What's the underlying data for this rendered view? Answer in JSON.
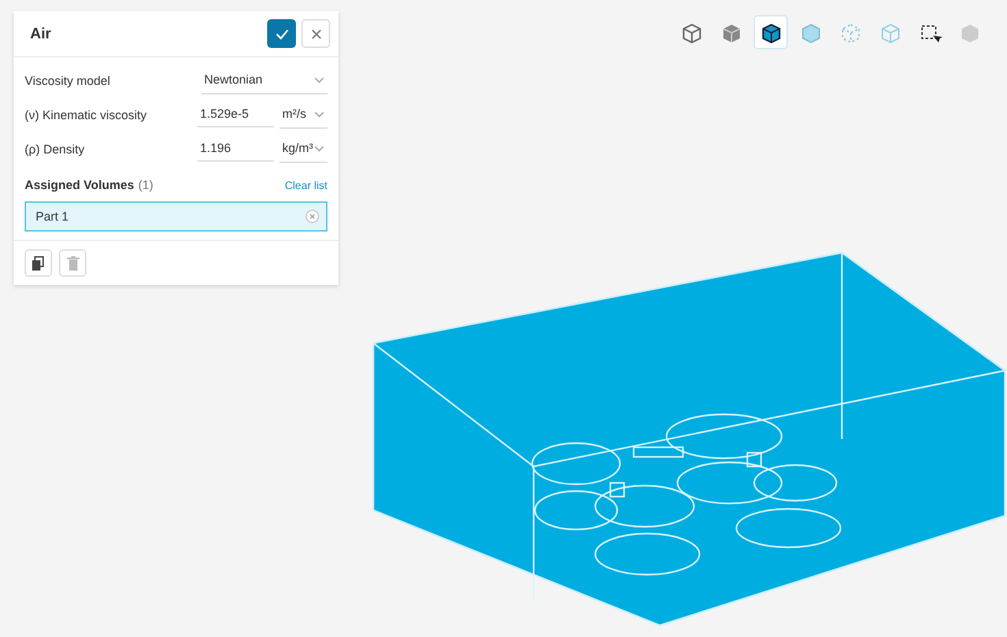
{
  "panel": {
    "title": "Air",
    "fields": [
      {
        "kind": "select",
        "label": "Viscosity model",
        "value": "Newtonian"
      },
      {
        "kind": "unit",
        "label": "(ν) Kinematic viscosity",
        "value": "1.529e-5",
        "unit": "m²/s"
      },
      {
        "kind": "unit",
        "label": "(ρ) Density",
        "value": "1.196",
        "unit": "kg/m³"
      }
    ],
    "assigned": {
      "title": "Assigned Volumes",
      "count": "(1)",
      "clear": "Clear list",
      "items": [
        {
          "label": "Part 1",
          "selected": true
        }
      ]
    }
  },
  "toolbar": [
    {
      "kind": "wire",
      "selected": false
    },
    {
      "kind": "solid",
      "selected": false
    },
    {
      "kind": "solidedge",
      "selected": true
    },
    {
      "kind": "transparent",
      "selected": false
    },
    {
      "kind": "points",
      "selected": false
    },
    {
      "kind": "outline",
      "selected": false
    },
    {
      "kind": "boxselect",
      "selected": false
    },
    {
      "kind": "faded",
      "selected": false
    }
  ]
}
